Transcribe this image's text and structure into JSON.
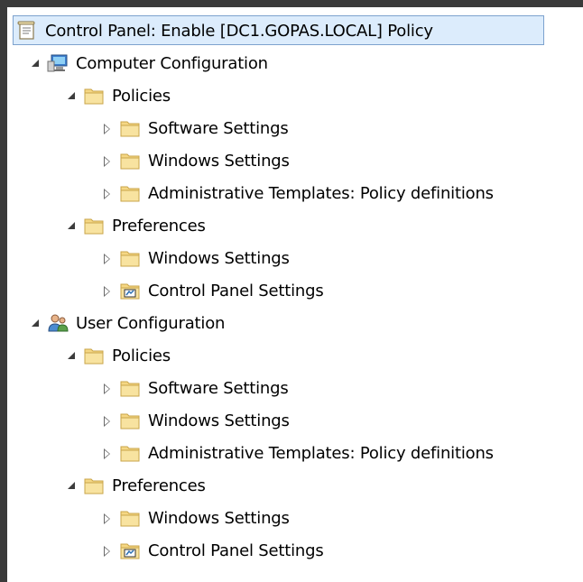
{
  "tree": {
    "root": {
      "label": "Control Panel: Enable [DC1.GOPAS.LOCAL] Policy",
      "icon": "policy-document-icon"
    },
    "items": [
      {
        "label": "Computer Configuration",
        "icon": "computer-icon",
        "state": "expanded"
      },
      {
        "label": "Policies",
        "icon": "folder-icon",
        "state": "expanded"
      },
      {
        "label": "Software Settings",
        "icon": "folder-icon",
        "state": "collapsed"
      },
      {
        "label": "Windows Settings",
        "icon": "folder-icon",
        "state": "collapsed"
      },
      {
        "label": "Administrative Templates: Policy definitions",
        "icon": "folder-icon",
        "state": "collapsed"
      },
      {
        "label": "Preferences",
        "icon": "folder-icon",
        "state": "expanded"
      },
      {
        "label": "Windows Settings",
        "icon": "folder-icon",
        "state": "collapsed"
      },
      {
        "label": "Control Panel Settings",
        "icon": "control-panel-folder-icon",
        "state": "collapsed"
      },
      {
        "label": "User Configuration",
        "icon": "user-icon",
        "state": "expanded"
      },
      {
        "label": "Policies",
        "icon": "folder-icon",
        "state": "expanded"
      },
      {
        "label": "Software Settings",
        "icon": "folder-icon",
        "state": "collapsed"
      },
      {
        "label": "Windows Settings",
        "icon": "folder-icon",
        "state": "collapsed"
      },
      {
        "label": "Administrative Templates: Policy definitions",
        "icon": "folder-icon",
        "state": "collapsed"
      },
      {
        "label": "Preferences",
        "icon": "folder-icon",
        "state": "expanded"
      },
      {
        "label": "Windows Settings",
        "icon": "folder-icon",
        "state": "collapsed"
      },
      {
        "label": "Control Panel Settings",
        "icon": "control-panel-folder-icon",
        "state": "collapsed"
      }
    ]
  },
  "colors": {
    "selection_bg": "#dcecfc",
    "selection_border": "#7da2ce",
    "folder": "#f5d784",
    "background": "#ffffff"
  }
}
